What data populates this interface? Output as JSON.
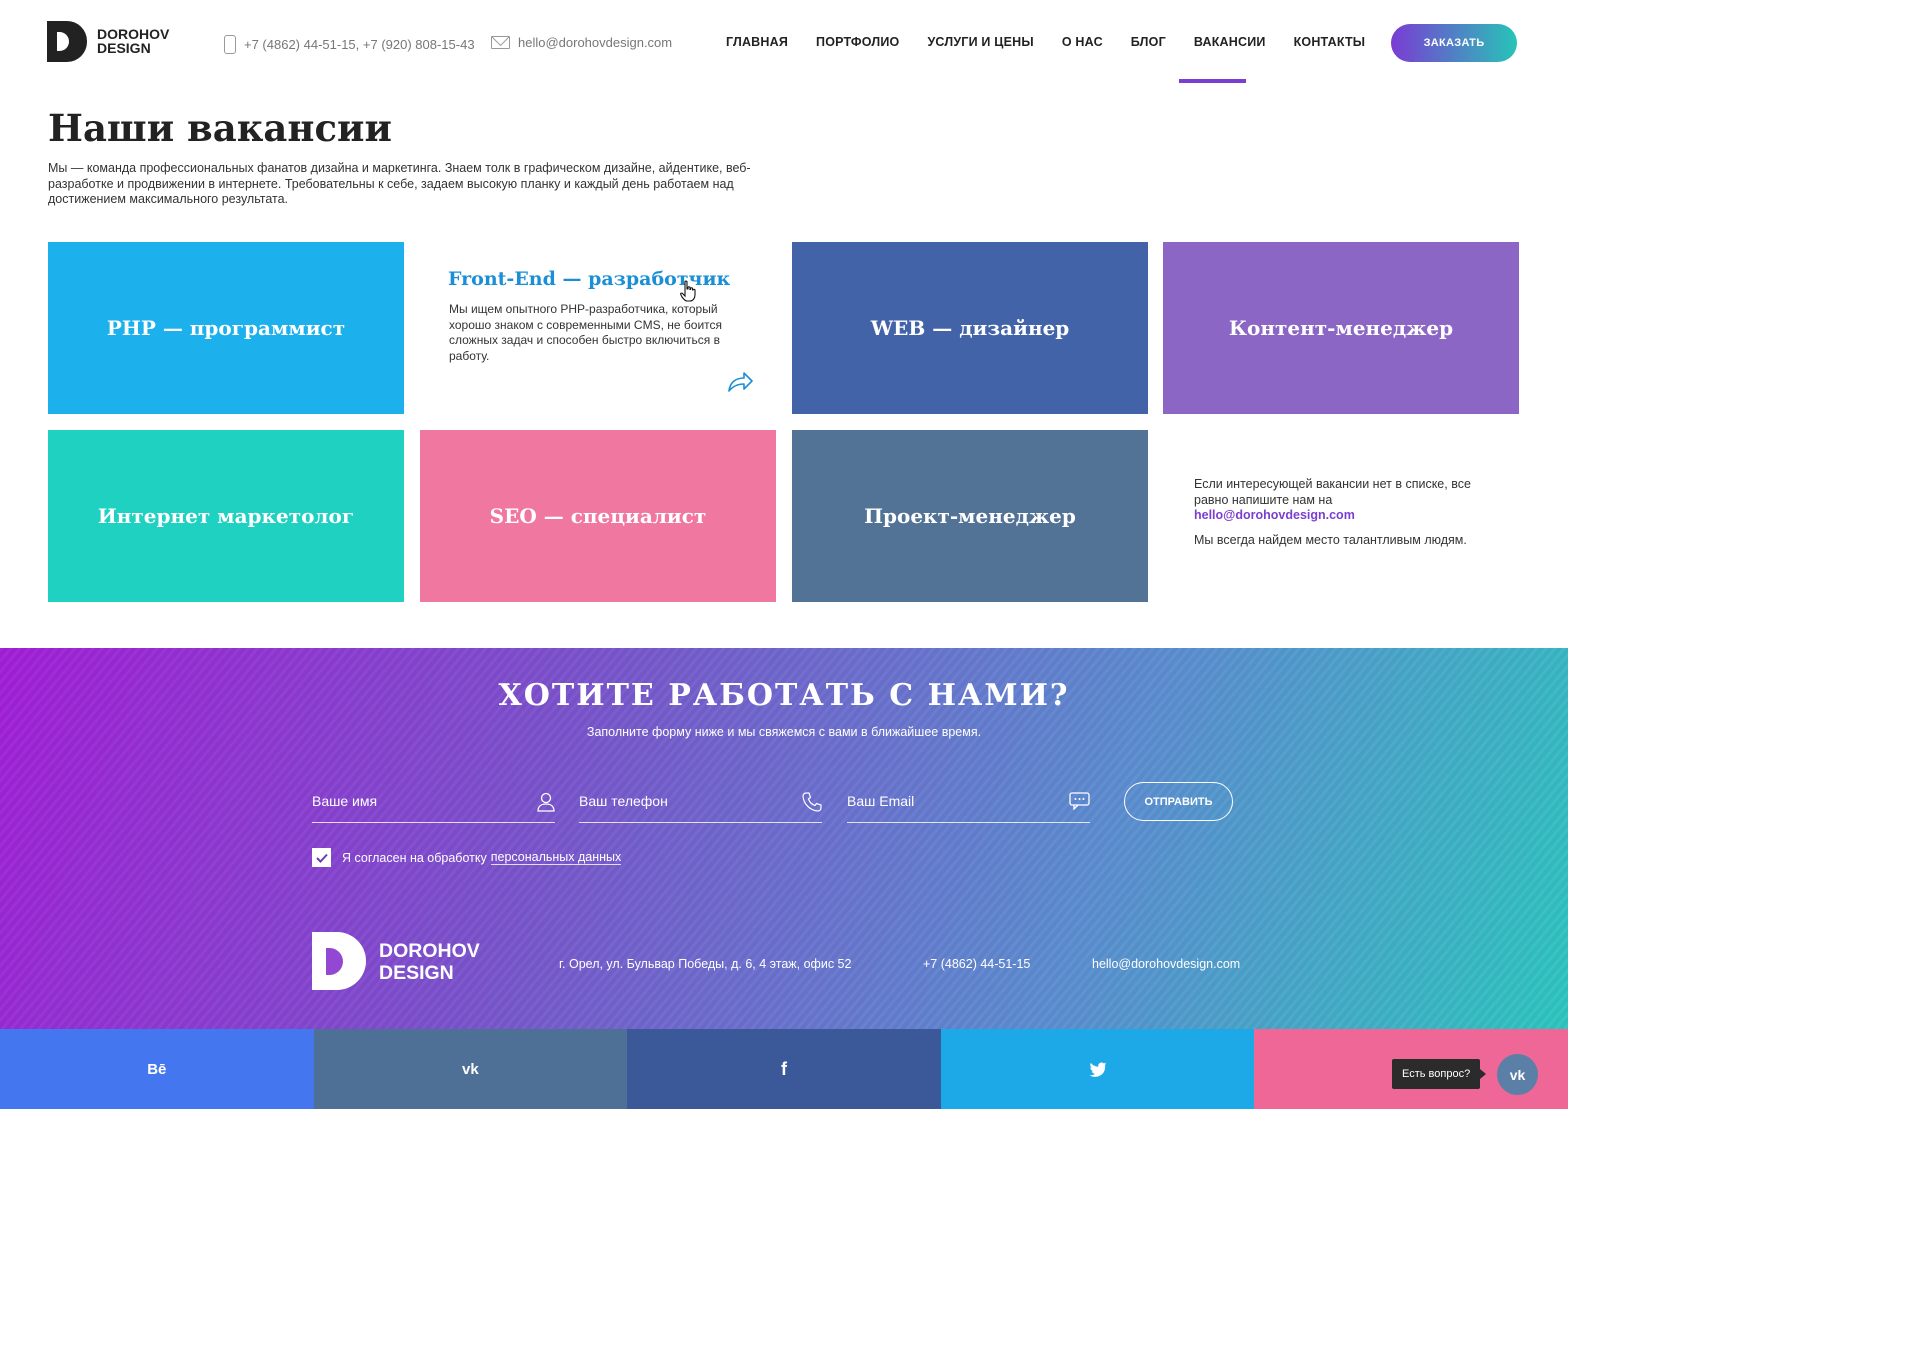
{
  "header": {
    "logo_text": "DOROHOV DESIGN",
    "phones": "+7 (4862) 44-51-15,  +7 (920) 808-15-43",
    "email": "hello@dorohovdesign.com",
    "nav": [
      "ГЛАВНАЯ",
      "ПОРТФОЛИО",
      "УСЛУГИ И ЦЕНЫ",
      "О НАС",
      "БЛОГ",
      "ВАКАНСИИ",
      "КОНТАКТЫ"
    ],
    "active_nav": "ВАКАНСИИ",
    "order_button": "ЗАКАЗАТЬ"
  },
  "page": {
    "title": "Наши вакансии",
    "intro": "Мы — команда профессиональных фанатов дизайна и маркетинга. Знаем толк в графическом дизайне, айдентике, веб-разработке и продвижении в интернете. Требовательны к себе, задаем высокую планку и каждый день работаем над достижением максимального результата."
  },
  "vacancies": {
    "php": "PHP — программист",
    "frontend": {
      "title": "Front-End — разработчик",
      "description": "Мы ищем опытного PHP-разработчика, который хорошо знаком с современными CMS, не боится сложных задач и способен быстро включиться в работу."
    },
    "web": "WEB — дизайнер",
    "content": "Контент-менеджер",
    "marketing": "Интернет маркетолог",
    "seo": "SEO — специалист",
    "pm": "Проект-менеджер"
  },
  "no_vacancy": {
    "line1": "Если интересующей вакансии нет в списке, все равно напишите нам на",
    "email": "hello@dorohovdesign.com",
    "line2": "Мы всегда найдем место талантливым людям."
  },
  "cta": {
    "title": "ХОТИТЕ РАБОТАТЬ С НАМИ?",
    "subtitle": "Заполните форму ниже и мы свяжемся с вами в ближайшее время.",
    "name_placeholder": "Ваше имя",
    "phone_placeholder": "Ваш телефон",
    "email_placeholder": "Ваш Email",
    "send": "ОТПРАВИТЬ",
    "agree_text": "Я согласен на обработку",
    "agree_link": "персональных данных",
    "agree_checked": true
  },
  "footer": {
    "logo_line1": "DOROHOV",
    "logo_line2": "DESIGN",
    "address": "г. Орел, ул. Бульвар Победы, д. 6, 4 этаж, офис 52",
    "phone": "+7 (4862) 44-51-15",
    "email": "hello@dorohovdesign.com"
  },
  "social": {
    "behance": "Bē",
    "vk": "vk",
    "facebook": "f",
    "twitter": "twitter-icon",
    "instagram": "instagram-icon",
    "ask": "Есть вопрос?",
    "vk_chat": "vk"
  },
  "colors": {
    "accent": "#7b3fd0",
    "php": "#1cb1ec",
    "web": "#4363a9",
    "content": "#8c66c5",
    "marketing": "#1fd1c0",
    "seo": "#f077a0",
    "pm": "#527296",
    "frontend_title": "#1a8fd6"
  }
}
